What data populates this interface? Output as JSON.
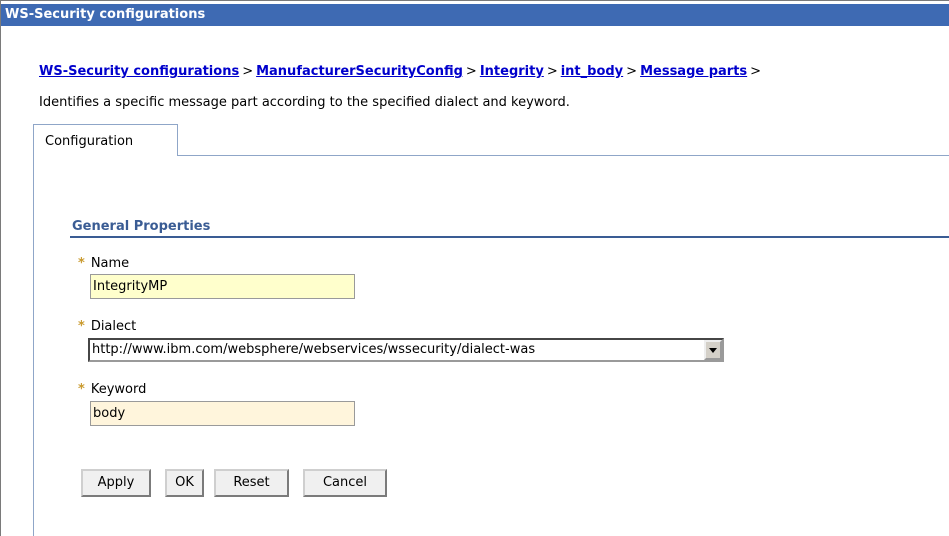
{
  "window": {
    "title": "WS-Security configurations"
  },
  "breadcrumb": {
    "items": [
      {
        "label": "WS-Security configurations"
      },
      {
        "label": "ManufacturerSecurityConfig"
      },
      {
        "label": "Integrity"
      },
      {
        "label": "int_body"
      },
      {
        "label": "Message parts"
      }
    ],
    "separator": ">"
  },
  "page": {
    "description": "Identifies a specific message part according to the specified dialect and keyword."
  },
  "tabs": [
    {
      "label": "Configuration",
      "selected": true
    }
  ],
  "general_properties": {
    "title": "General Properties",
    "required_marker": "*",
    "name": {
      "label": "Name",
      "value": "IntegrityMP",
      "background": "#ffffcc"
    },
    "dialect": {
      "label": "Dialect",
      "selected": "http://www.ibm.com/websphere/webservices/wssecurity/dialect-was"
    },
    "keyword": {
      "label": "Keyword",
      "value": "body",
      "background": "#fff5dc"
    }
  },
  "buttons": {
    "apply": "Apply",
    "ok": "OK",
    "reset": "Reset",
    "cancel": "Cancel"
  },
  "colors": {
    "title_bar": "#3e6ab3",
    "link": "#0000cc",
    "section_title": "#3a5c94",
    "required_marker": "#c99a2e"
  },
  "icons": {
    "dropdown": "chevron-down-icon"
  }
}
